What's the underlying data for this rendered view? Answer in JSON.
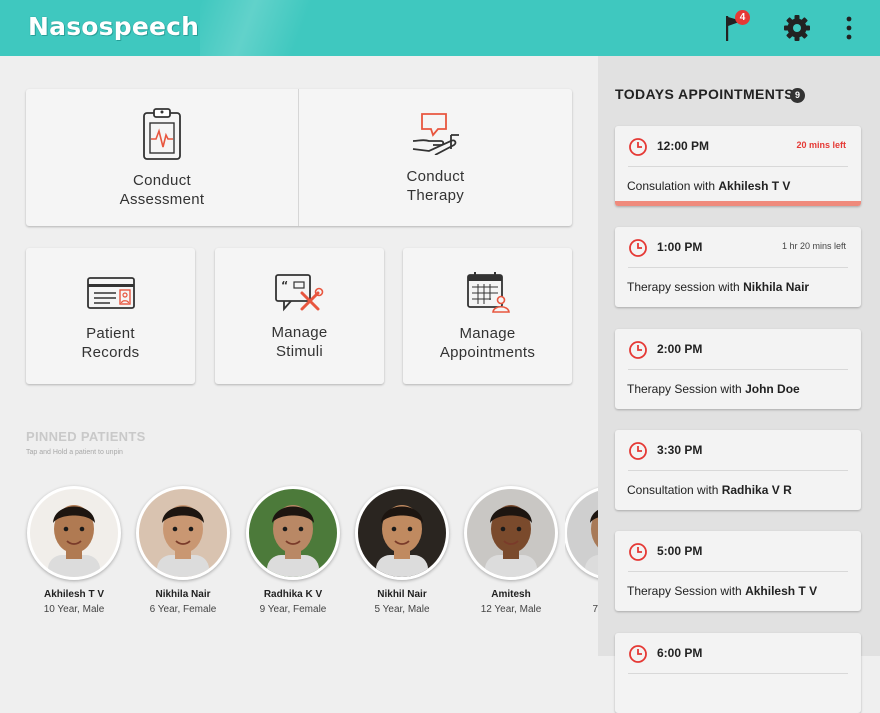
{
  "app": {
    "title": "Nasospeech",
    "notification_count": "4"
  },
  "tiles": [
    {
      "label": "Conduct\nAssessment",
      "icon": "clipboard-ecg-icon"
    },
    {
      "label": "Conduct\nTherapy",
      "icon": "hand-speech-icon"
    },
    {
      "label": "Patient\nRecords",
      "icon": "id-card-icon"
    },
    {
      "label": "Manage\nStimuli",
      "icon": "stimuli-tools-icon"
    },
    {
      "label": "Manage\nAppointments",
      "icon": "calendar-user-icon"
    }
  ],
  "pinned": {
    "title": "PINNED PATIENTS",
    "subtitle": "Tap and Hold a patient to unpin",
    "patients": [
      {
        "name": "Akhilesh T V",
        "info": "10 Year, Male",
        "bg": "#f1eeea",
        "skin": "#b07a52"
      },
      {
        "name": "Nikhila Nair",
        "info": "6 Year, Female",
        "bg": "#d9c3b0",
        "skin": "#c99772"
      },
      {
        "name": "Radhika K V",
        "info": "9 Year, Female",
        "bg": "#4c7a3a",
        "skin": "#b98865"
      },
      {
        "name": "Nikhil Nair",
        "info": "5 Year, Male",
        "bg": "#2a2520",
        "skin": "#c08a60"
      },
      {
        "name": "Amitesh",
        "info": "12 Year, Male",
        "bg": "#c9c7c4",
        "skin": "#7a4a2c"
      },
      {
        "name": "",
        "info": "7",
        "bg": "#cfcfcf",
        "skin": "#a87a58"
      }
    ]
  },
  "appointments": {
    "title": "TODAYS APPOINTMENTS",
    "count": "9",
    "items": [
      {
        "time": "12:00 PM",
        "left": "20 mins left",
        "prefix": "Consulation with ",
        "person": "Akhilesh T V",
        "urgent": true
      },
      {
        "time": "1:00 PM",
        "left": "1 hr 20 mins left",
        "prefix": "Therapy session with ",
        "person": "Nikhila Nair",
        "urgent": false
      },
      {
        "time": "2:00 PM",
        "left": "",
        "prefix": "Therapy Session with ",
        "person": "John Doe",
        "urgent": false
      },
      {
        "time": "3:30 PM",
        "left": "",
        "prefix": "Consultation with ",
        "person": "Radhika V R",
        "urgent": false
      },
      {
        "time": "5:00 PM",
        "left": "",
        "prefix": "Therapy Session with ",
        "person": "Akhilesh T V",
        "urgent": false
      },
      {
        "time": "6:00 PM",
        "left": "",
        "prefix": "",
        "person": "",
        "urgent": false
      }
    ]
  },
  "colors": {
    "primary": "#3fc8bf",
    "accent": "#e53935",
    "icon_line": "#333333",
    "icon_accent": "#e8563f"
  }
}
